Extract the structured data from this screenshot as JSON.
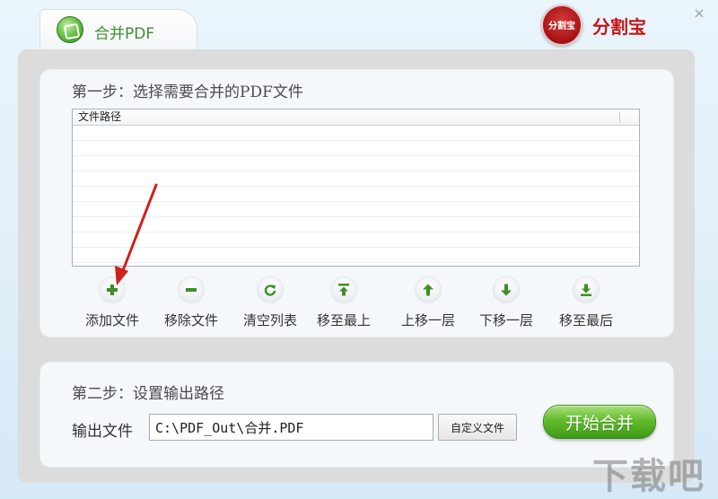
{
  "tab": {
    "title": "合并PDF",
    "icon": "pdf-merge-icon"
  },
  "brand": {
    "logo_text": "分割宝",
    "name": "分割宝"
  },
  "window": {
    "close_glyph": "×"
  },
  "step1": {
    "title": "第一步：选择需要合并的PDF文件",
    "list_header": "文件路径",
    "rows": [
      "",
      "",
      "",
      "",
      "",
      "",
      "",
      "",
      ""
    ]
  },
  "toolbar": [
    {
      "label": "添加文件",
      "icon": "plus-icon"
    },
    {
      "label": "移除文件",
      "icon": "minus-icon"
    },
    {
      "label": "清空列表",
      "icon": "refresh-icon"
    },
    {
      "label": "移至最上",
      "icon": "move-top-icon"
    },
    {
      "label": "上移一层",
      "icon": "arrow-up-icon"
    },
    {
      "label": "下移一层",
      "icon": "arrow-down-icon"
    },
    {
      "label": "移至最后",
      "icon": "move-bottom-icon"
    }
  ],
  "step2": {
    "title": "第二步：设置输出路径",
    "output_label": "输出文件",
    "output_value": "C:\\PDF_Out\\合并.PDF",
    "custom_button": "自定义文件",
    "start_button": "开始合并"
  },
  "colors": {
    "accent_green": "#3f9a1a",
    "brand_red": "#c21717",
    "annotation_red": "#d0201a"
  },
  "watermark": {
    "text": "下载吧"
  }
}
